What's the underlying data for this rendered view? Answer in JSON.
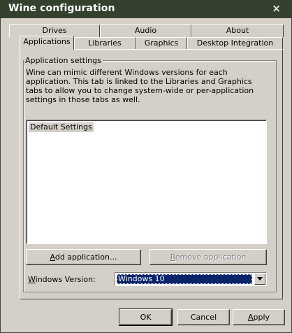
{
  "window": {
    "title": "Wine configuration",
    "close_glyph": "×"
  },
  "tabs": {
    "row1": [
      "Drives",
      "Audio",
      "About"
    ],
    "row2": [
      "Applications",
      "Libraries",
      "Graphics",
      "Desktop Integration"
    ],
    "active": "Applications"
  },
  "app_settings": {
    "group_label": "Application settings",
    "description": "Wine can mimic different Windows versions for each application. This tab is linked to the Libraries and Graphics tabs to allow you to change system-wide or per-application settings in those tabs as well.",
    "list_items": [
      "Default Settings"
    ],
    "add_button": {
      "mnemonic": "A",
      "rest": "dd application..."
    },
    "remove_button": {
      "mnemonic": "R",
      "rest": "emove application",
      "enabled": false
    },
    "windows_version_label": {
      "mnemonic": "W",
      "rest": "indows Version:"
    },
    "windows_version_value": "Windows 10"
  },
  "footer": {
    "ok": "OK",
    "cancel": "Cancel",
    "apply": {
      "mnemonic": "A",
      "rest": "pply"
    }
  },
  "colors": {
    "titlebar": "#35412f",
    "face": "#d4d0c8",
    "selection": "#0a246a"
  },
  "icons": {
    "close": "close-icon",
    "dropdown": "chevron-down-icon"
  }
}
